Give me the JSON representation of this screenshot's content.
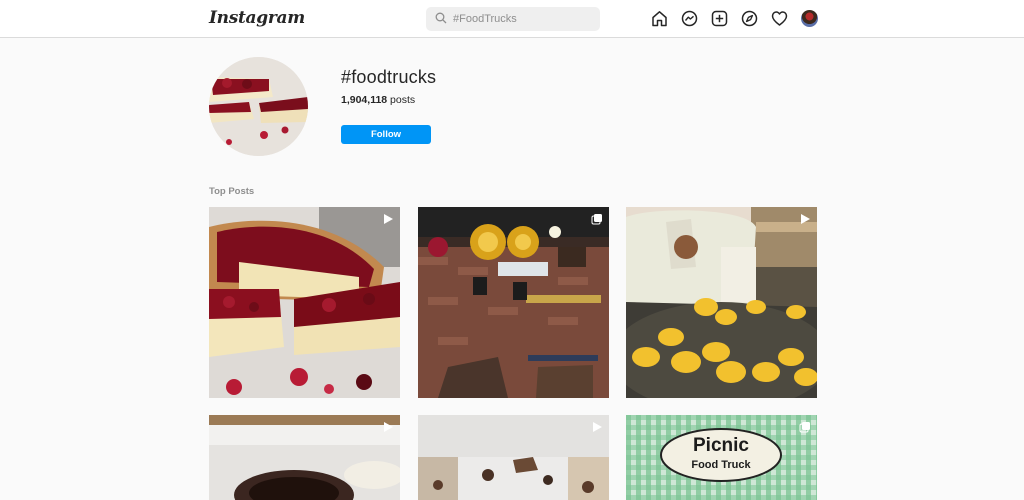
{
  "header": {
    "logo": "Instagram",
    "search_placeholder": "#FoodTrucks",
    "nav_icons": [
      "home-icon",
      "messenger-icon",
      "new-post-icon",
      "explore-icon",
      "activity-heart-icon",
      "profile-avatar"
    ]
  },
  "hashtag": {
    "name": "#foodtrucks",
    "posts_count": "1,904,118",
    "posts_label": " posts",
    "follow_label": "Follow"
  },
  "top_posts": {
    "label": "Top Posts",
    "items": [
      {
        "subject": "berry tart slice",
        "badge": "video-icon"
      },
      {
        "subject": "cafe interior brick wall",
        "badge": "carousel-icon"
      },
      {
        "subject": "frying snacks thumbs up",
        "badge": "video-icon"
      },
      {
        "subject": "chocolate dessert",
        "badge": "video-icon"
      },
      {
        "subject": "cookies on table",
        "badge": "video-icon"
      },
      {
        "subject": "Picnic Food Truck sign",
        "badge": "carousel-icon"
      }
    ]
  },
  "sign_text": {
    "line1": "Picnic",
    "line2": "Food Truck"
  },
  "colors": {
    "accent": "#0095f6",
    "background": "#fafafa",
    "border": "#dbdbdb"
  }
}
